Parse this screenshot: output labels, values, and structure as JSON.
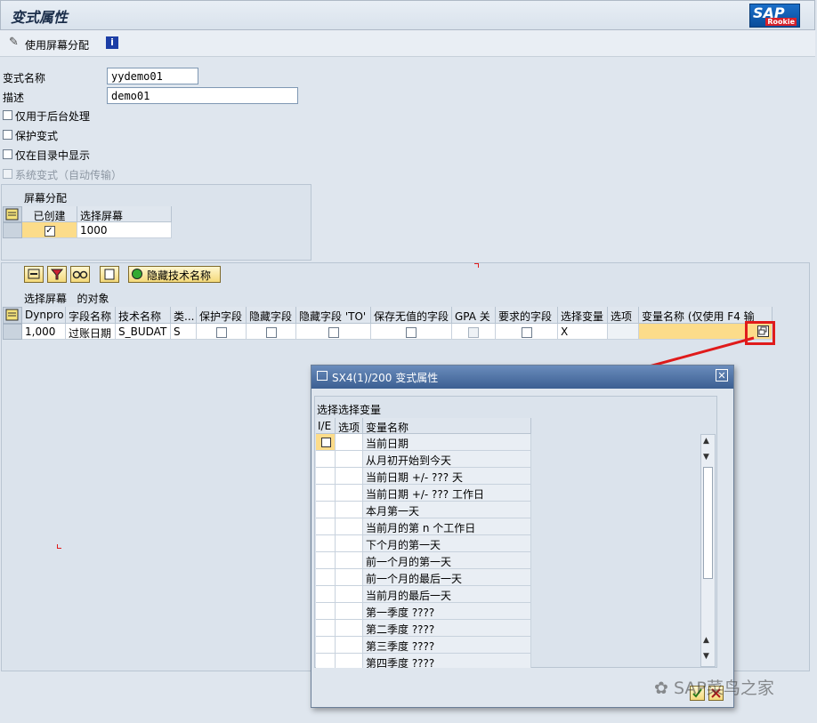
{
  "window": {
    "title": "变式属性",
    "logo": {
      "brand": "SAP",
      "sub": "Rookie"
    }
  },
  "toolbar": {
    "screen_assign": "使用屏幕分配"
  },
  "form": {
    "variant_name_label": "变式名称",
    "variant_name_value": "yydemo01",
    "desc_label": "描述",
    "desc_value": "demo01",
    "checkboxes": [
      {
        "label": "仅用于后台处理",
        "checked": false,
        "disabled": false
      },
      {
        "label": "保护变式",
        "checked": false,
        "disabled": false
      },
      {
        "label": "仅在目录中显示",
        "checked": false,
        "disabled": false
      },
      {
        "label": "系统变式（自动传输）",
        "checked": false,
        "disabled": true
      }
    ]
  },
  "screen_assignment": {
    "title": "屏幕分配",
    "headers": [
      "已创建",
      "选择屏幕"
    ],
    "row": {
      "created": true,
      "screen": "1000"
    }
  },
  "objects": {
    "hide_tech_button": "隐藏技术名称",
    "title": "选择屏幕   的对象",
    "headers": [
      "Dynpro",
      "字段名称",
      "技术名称",
      "类...",
      "保护字段",
      "隐藏字段",
      "隐藏字段 'TO'",
      "保存无值的字段",
      "GPA 关",
      "要求的字段",
      "选择变量",
      "选项",
      "变量名称 (仅使用 F4 输"
    ],
    "row": {
      "dynpro": "1,000",
      "field": "过账日期",
      "tech": "S_BUDAT",
      "type": "S",
      "sel_var": "X"
    }
  },
  "dialog": {
    "title": "SX4(1)/200 变式属性",
    "section": "选择选择变量",
    "headers": [
      "I/E",
      "选项",
      "变量名称"
    ],
    "items": [
      "当前日期",
      "从月初开始到今天",
      "当前日期 +/- ??? 天",
      "当前日期 +/- ??? 工作日",
      "本月第一天",
      "当前月的第 n 个工作日",
      "下个月的第一天",
      "前一个月的第一天",
      "前一个月的最后一天",
      "当前月的最后一天",
      "第一季度 ????",
      "第二季度 ????",
      "第三季度 ????",
      "第四季度 ????"
    ]
  },
  "watermark": "SAP菜鸟之家",
  "colors": {
    "accent_red": "#e01b1b",
    "selected": "#fcdc8a",
    "title_blue": "#3b5f92"
  }
}
